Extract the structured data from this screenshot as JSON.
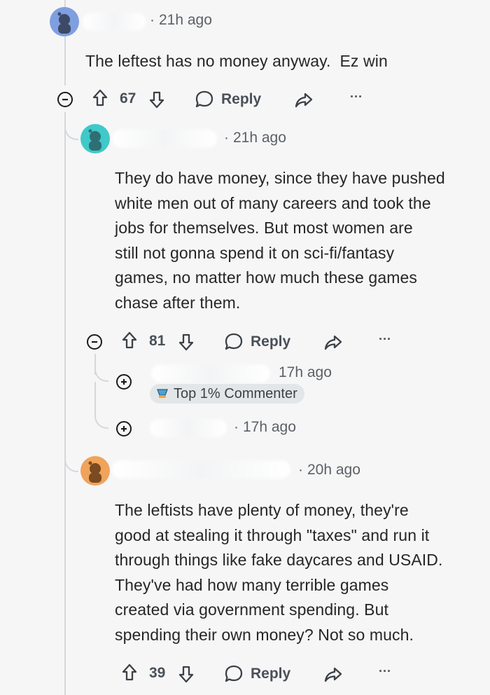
{
  "comments": [
    {
      "time": "21h ago",
      "body": "The leftest has no money anyway.  Ez win",
      "votes": "67",
      "reply_label": "Reply",
      "more": "···"
    },
    {
      "time": "21h ago",
      "body_lines": [
        "They do have money, since they have pushed",
        "white men out of many careers and took the",
        "jobs for themselves. But most women are",
        "still not gonna spend it on sci-fi/fantasy",
        "games, no matter how much these games",
        "chase after them."
      ],
      "votes": "81",
      "reply_label": "Reply",
      "more": "···"
    },
    {
      "time": "17h ago",
      "badge": "Top 1% Commenter"
    },
    {
      "time": "17h ago"
    },
    {
      "time": "20h ago",
      "body_lines": [
        "The leftists have plenty of money, they're",
        "good at stealing it through \"taxes\" and run it",
        "through things like fake daycares and USAID.",
        "They've had how many terrible games",
        "created via government spending. But",
        "spending their own money? Not so much."
      ],
      "votes": "39",
      "reply_label": "Reply",
      "more": "···"
    }
  ],
  "icons": {
    "upvote": "arrow-up-icon",
    "downvote": "arrow-down-icon",
    "reply": "speech-bubble-icon",
    "share": "share-arrow-icon",
    "collapse": "minus-circle-icon",
    "expand": "plus-circle-icon"
  },
  "colors": {
    "avatar1": "#7f9fe0",
    "avatar2": "#3fc9c9",
    "avatar3": "#f0a35a",
    "background": "#f6f6f7",
    "thread_line": "#d5d8db"
  }
}
